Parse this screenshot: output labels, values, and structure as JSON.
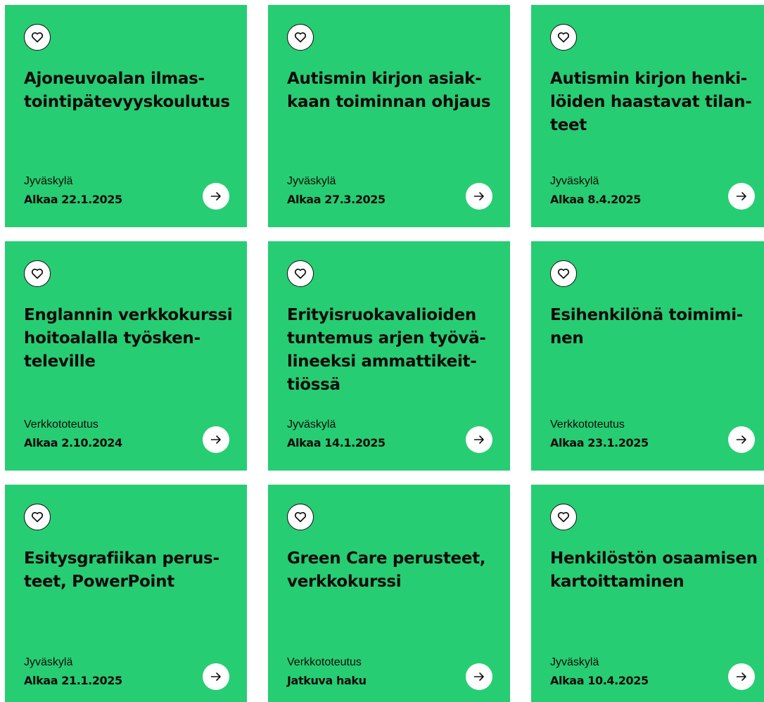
{
  "colors": {
    "card_background": "#27cd72",
    "text": "#0b0b0b",
    "icon_background": "#ffffff"
  },
  "icons": {
    "favorite": "heart-icon",
    "open": "arrow-right-icon"
  },
  "cards": [
    {
      "title": "Ajoneuvoalan ilmas­tointipätevyyskoulu­tus",
      "location": "Jyväskylä",
      "date": "Alkaa 22.1.2025"
    },
    {
      "title": "Autismin kirjon asiak­kaan toiminnan ohjaus",
      "location": "Jyväskylä",
      "date": "Alkaa 27.3.2025"
    },
    {
      "title": "Autismin kirjon henki­löiden haastavat tilan­teet",
      "location": "Jyväskylä",
      "date": "Alkaa 8.4.2025"
    },
    {
      "title": "Englannin verkkokurs­si hoitoalalla työsken­televille",
      "location": "Verkkototeutus",
      "date": "Alkaa 2.10.2024"
    },
    {
      "title": "Erityisruokavalioiden tuntemus arjen työvä­lineeksi ammattikeit­tiössä",
      "location": "Jyväskylä",
      "date": "Alkaa 14.1.2025"
    },
    {
      "title": "Esihenkilönä toimimi­nen",
      "location": "Verkkototeutus",
      "date": "Alkaa 23.1.2025"
    },
    {
      "title": "Esitysgrafiikan perus­teet, PowerPoint",
      "location": "Jyväskylä",
      "date": "Alkaa 21.1.2025"
    },
    {
      "title": "Green Care perusteet, verkkokurssi",
      "location": "Verkkototeutus",
      "date": "Jatkuva haku"
    },
    {
      "title": "Henkilöstön osaami­sen kartoittaminen",
      "location": "Jyväskylä",
      "date": "Alkaa 10.4.2025"
    }
  ]
}
